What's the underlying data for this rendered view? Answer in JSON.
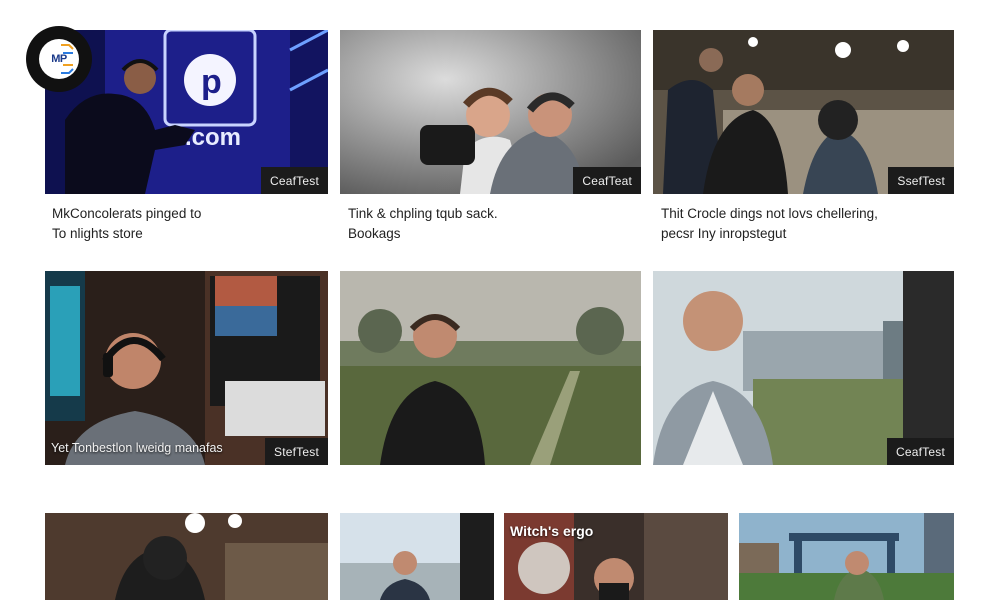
{
  "logo": {
    "text": "MP"
  },
  "row1": [
    {
      "badge": "CeafTest",
      "line1": "MkConcolerats pinged to",
      "line2": "To nlights store"
    },
    {
      "badge": "CeafTeat",
      "line1": "Tink & chpling tqub sack.",
      "line2": "Bookags"
    },
    {
      "badge": "SsefTest",
      "line1": "Thit Crocle dings not lovs chellering,",
      "line2": "pecsr Iny inropstegut"
    }
  ],
  "row2": [
    {
      "badge": "StefTest",
      "overlay": "Yet Tonbestlon lweidg manafas"
    },
    {
      "badge": ""
    },
    {
      "badge": "CeafTest"
    }
  ],
  "row3": [
    {
      "overlay": ""
    },
    {
      "overlay": ""
    },
    {
      "overlay": "Witch's ergo"
    },
    {
      "overlay": ""
    }
  ],
  "colors": {
    "badge_bg": "#1b1b1b",
    "page_bg": "#ffffff"
  }
}
